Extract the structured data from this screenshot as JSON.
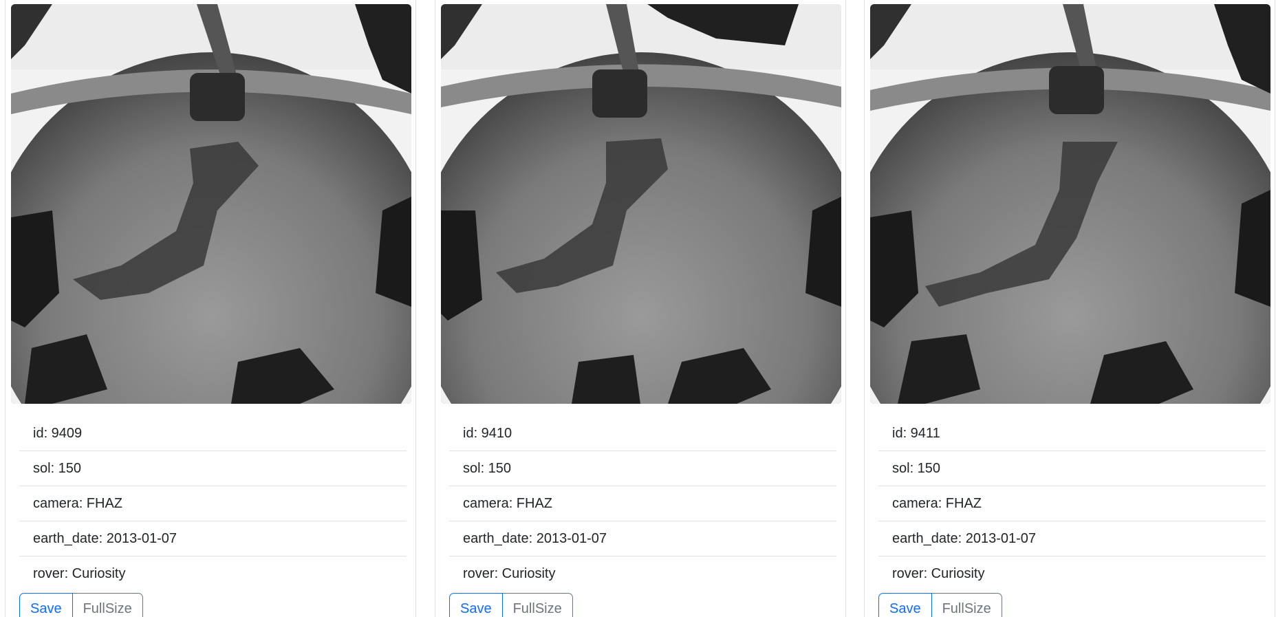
{
  "photos": [
    {
      "id": "id: 9409",
      "sol": "sol: 150",
      "camera": "camera: FHAZ",
      "earth_date": "earth_date: 2013-01-07",
      "rover": "rover: Curiosity",
      "save_label": "Save",
      "fullsize_label": "FullSize"
    },
    {
      "id": "id: 9410",
      "sol": "sol: 150",
      "camera": "camera: FHAZ",
      "earth_date": "earth_date: 2013-01-07",
      "rover": "rover: Curiosity",
      "save_label": "Save",
      "fullsize_label": "FullSize"
    },
    {
      "id": "id: 9411",
      "sol": "sol: 150",
      "camera": "camera: FHAZ",
      "earth_date": "earth_date: 2013-01-07",
      "rover": "rover: Curiosity",
      "save_label": "Save",
      "fullsize_label": "FullSize"
    }
  ],
  "colors": {
    "primary": "#0d6efd",
    "secondary": "#6c757d",
    "border": "#dee2e6",
    "text": "#212529"
  }
}
